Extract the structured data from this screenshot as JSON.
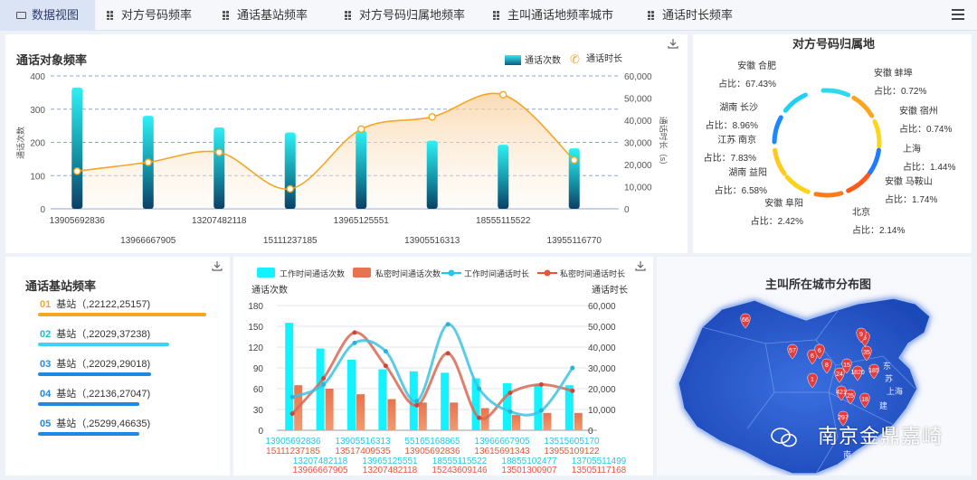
{
  "tabs": [
    {
      "label": "数据视图",
      "active": true
    },
    {
      "label": "对方号码频率"
    },
    {
      "label": "通话基站频率"
    },
    {
      "label": "对方号码归属地频率"
    },
    {
      "label": "主叫通话地频率城市"
    },
    {
      "label": "通话时长频率"
    }
  ],
  "call_target": {
    "title": "通话对象频率",
    "legend_count": "通话次数",
    "legend_duration": "通话时长",
    "ylabel_left": "通话次数",
    "ylabel_right": "通话时长（s）",
    "chart_data": {
      "type": "bar",
      "categories": [
        "13905692836",
        "13966667905",
        "13207482118",
        "15111237185",
        "13965125551",
        "13905516313",
        "18555115522",
        "13955116770"
      ],
      "series": [
        {
          "name": "通话次数",
          "type": "bar",
          "values": [
            365,
            280,
            245,
            230,
            235,
            205,
            193,
            182
          ]
        },
        {
          "name": "通话时长",
          "type": "line",
          "values": [
            17000,
            21000,
            25500,
            9000,
            36000,
            41500,
            51500,
            22000
          ]
        }
      ],
      "ylim": [
        0,
        400
      ],
      "y2lim": [
        0,
        60000
      ],
      "yticks": [
        "0",
        "100",
        "200",
        "300",
        "400"
      ],
      "y2ticks": [
        "0",
        "10,000",
        "20,000",
        "30,000",
        "40,000",
        "50,000",
        "60,000"
      ]
    }
  },
  "attribution": {
    "title": "对方号码归属地",
    "labels": [
      {
        "name": "安徽 合肥",
        "pct": "占比：67.43%"
      },
      {
        "name": "安徽 蚌埠",
        "pct": "占比：0.72%"
      },
      {
        "name": "安徽 宿州",
        "pct": "占比：0.74%"
      },
      {
        "name": "上海",
        "pct": "占比：1.44%"
      },
      {
        "name": "安徽 马鞍山",
        "pct": "占比：1.74%"
      },
      {
        "name": "北京",
        "pct": "占比：2.14%"
      },
      {
        "name": "安徽 阜阳",
        "pct": "占比：2.42%"
      },
      {
        "name": "湖南 益阳",
        "pct": "占比：6.58%"
      },
      {
        "name": "江苏 南京",
        "pct": "占比：7.83%"
      },
      {
        "name": "湖南 长沙",
        "pct": "占比：8.96%"
      }
    ],
    "chart_data": {
      "type": "pie",
      "labels": [
        "安徽 合肥",
        "安徽 蚌埠",
        "安徽 宿州",
        "上海",
        "安徽 马鞍山",
        "北京",
        "安徽 阜阳",
        "湖南 益阳",
        "江苏 南京",
        "湖南 长沙"
      ],
      "values": [
        67.43,
        0.72,
        0.74,
        1.44,
        1.74,
        2.14,
        2.42,
        6.58,
        7.83,
        8.96
      ]
    }
  },
  "station": {
    "title": "通话基站频率",
    "rows": [
      {
        "idx": "01",
        "text": "基站（,22122,25157)",
        "level": 1.0,
        "color": "#f5a623"
      },
      {
        "idx": "02",
        "text": "基站（,22029,37238)",
        "level": 0.78,
        "color": "#3fd3f0"
      },
      {
        "idx": "03",
        "text": "基站（,22029,29018)",
        "level": 0.67,
        "color": "#1e88e5"
      },
      {
        "idx": "04",
        "text": "基站（,22136,27047)",
        "level": 0.6,
        "color": "#1e88e5"
      },
      {
        "idx": "05",
        "text": "基站（,25299,46635)",
        "level": 0.6,
        "color": "#1e88e5"
      }
    ]
  },
  "worktime": {
    "legend": [
      "工作时间通话次数",
      "私密时间通话次数",
      "工作时间通话时长",
      "私密时间通话时长"
    ],
    "ylabel_left": "通话次数",
    "ylabel_right": "通话时长",
    "xlabels_top": [
      "13905692836",
      "13905516313",
      "55165168865",
      "13966667905",
      "13515605170"
    ],
    "xlabels_mid": [
      "15111237185",
      "13517409535",
      "13905692836",
      "13615691343",
      "13955109122"
    ],
    "xlabels_low": [
      "13207482118",
      "13965125551",
      "18555115522",
      "18855102477",
      "13705511499"
    ],
    "xlabels_bottom": [
      "13966667905",
      "13207482118",
      "15243609146",
      "13501300907",
      "13505117168"
    ],
    "chart_data": {
      "type": "bar",
      "yticks": [
        "0",
        "30",
        "60",
        "90",
        "120",
        "150",
        "180"
      ],
      "y2ticks": [
        "0",
        "10,000",
        "20,000",
        "30,000",
        "40,000",
        "50,000",
        "60,000"
      ],
      "ylim": [
        0,
        180
      ],
      "y2lim": [
        0,
        60000
      ],
      "series": [
        {
          "name": "工作时间通话次数",
          "type": "bar",
          "values": [
            155,
            118,
            102,
            88,
            85,
            83,
            75,
            68,
            66,
            65
          ]
        },
        {
          "name": "私密时间通话次数",
          "type": "bar",
          "values": [
            65,
            60,
            52,
            45,
            40,
            40,
            32,
            22,
            25,
            25
          ]
        },
        {
          "name": "工作时间通话时长",
          "type": "line",
          "values": [
            16000,
            22000,
            42000,
            38000,
            14000,
            51000,
            20000,
            9000,
            9500,
            30000
          ]
        },
        {
          "name": "私密时间通话时长",
          "type": "line",
          "values": [
            8000,
            25000,
            47000,
            31000,
            12000,
            37000,
            6000,
            18000,
            22000,
            19000
          ]
        }
      ]
    }
  },
  "city_map": {
    "title": "主叫所在城市分布图",
    "pins": [
      "66",
      "57",
      "6",
      "6",
      "8",
      "15",
      "24",
      "1820",
      "185",
      "25",
      "18",
      "421",
      "5",
      "35",
      "1",
      "297",
      "9"
    ],
    "labels": [
      "东",
      "苏",
      "上海",
      "建",
      "南"
    ]
  },
  "watermark": "南京金鼎嘉崎"
}
